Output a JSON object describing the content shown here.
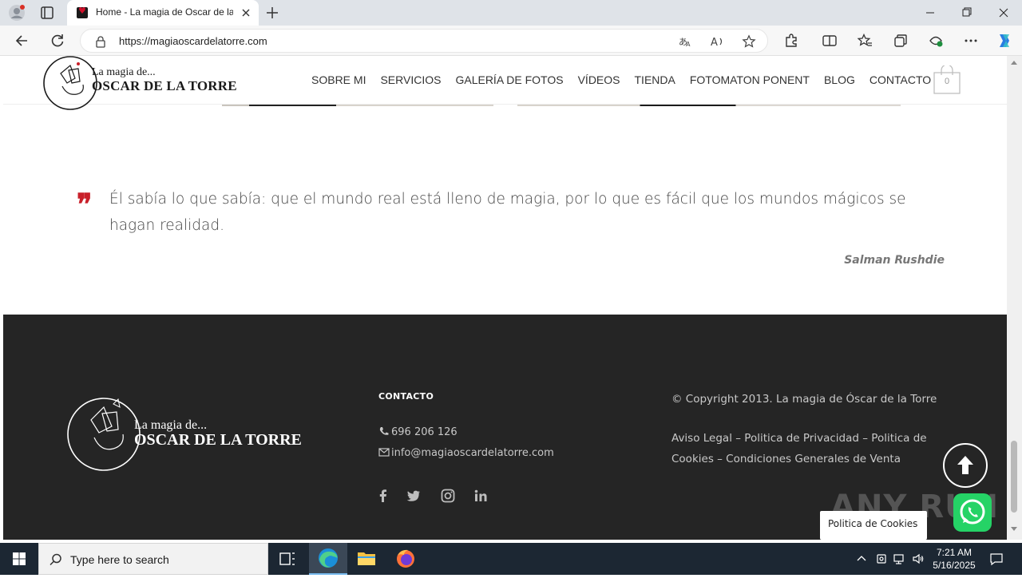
{
  "browser": {
    "tab_title": "Home - La magia de Oscar de la Torre",
    "url": "https://magiaoscardelatorre.com"
  },
  "header": {
    "logo_line1": "La magia de...",
    "logo_line2": "OSCAR DE LA TORRE",
    "nav": [
      "SOBRE MI",
      "SERVICIOS",
      "GALERÍA DE FOTOS",
      "VÍDEOS",
      "TIENDA",
      "FOTOMATON PONENT",
      "BLOG",
      "CONTACTO"
    ],
    "cart_count": "0"
  },
  "quote": {
    "mark": "❞",
    "text": "Él sabía lo que sabía: que el mundo real está lleno de magia, por lo que es fácil que los mundos mágicos se hagan realidad.",
    "author": "Salman Rushdie"
  },
  "footer": {
    "logo_line1": "La magia de...",
    "logo_line2": "OSCAR DE LA TORRE",
    "contact_heading": "CONTACTO",
    "phone": "696 206 126",
    "email": "info@magiaoscardelatorre.com",
    "social": [
      "facebook-icon",
      "twitter-icon",
      "instagram-icon",
      "linkedin-icon"
    ],
    "copyright": "© Copyright 2013. La magia de Óscar de la Torre",
    "legal": "Aviso Legal – Politica de Privacidad – Politica de Cookies – Condiciones Generales de Venta",
    "cookie_tab": "Politica de Cookies",
    "watermark": "ANY RUN"
  },
  "taskbar": {
    "search_placeholder": "Type here to search",
    "time": "7:21 AM",
    "date": "5/16/2025"
  },
  "colors": {
    "accent_red": "#c9202a",
    "footer_bg": "#252525",
    "taskbar_bg": "#1c2733"
  }
}
